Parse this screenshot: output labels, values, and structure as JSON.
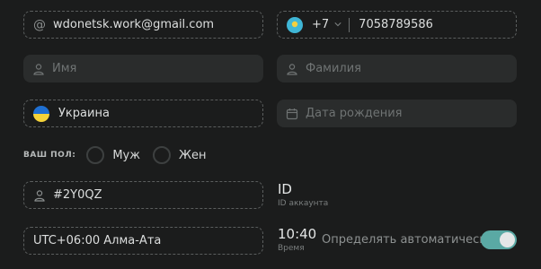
{
  "email": {
    "value": "wdonetsk.work@gmail.com"
  },
  "phone": {
    "code": "+7",
    "number": "7058789586"
  },
  "first_name": {
    "placeholder": "Имя"
  },
  "last_name": {
    "placeholder": "Фамилия"
  },
  "country": {
    "value": "Украина"
  },
  "birthdate": {
    "placeholder": "Дата рождения"
  },
  "gender": {
    "label": "ВАШ ПОЛ:",
    "options": [
      "Муж",
      "Жен"
    ]
  },
  "account": {
    "code": "#2Y0QZ",
    "id_title": "ID",
    "id_caption": "ID аккаунта"
  },
  "timezone": {
    "value": "UTC+06:00 Алма-Ата",
    "time": "10:40",
    "time_caption": "Время",
    "auto_label": "Определять автоматически",
    "auto_enabled": true
  },
  "colors": {
    "toggle_on": "#5aa9a4",
    "background": "#1b1c1c"
  }
}
